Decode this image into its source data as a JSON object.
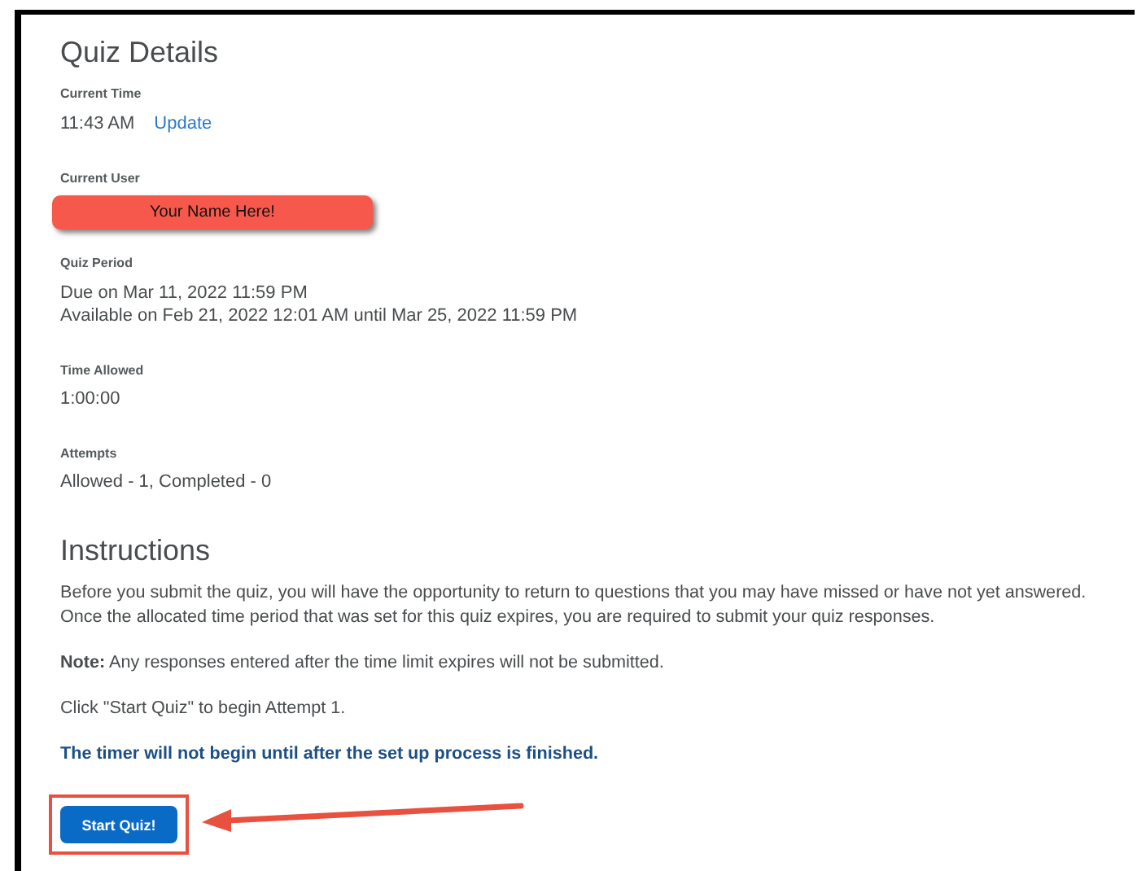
{
  "heading": "Quiz Details",
  "current_time": {
    "label": "Current Time",
    "value": "11:43 AM",
    "link": "Update"
  },
  "current_user": {
    "label": "Current User",
    "name": "Your Name Here!"
  },
  "quiz_period": {
    "label": "Quiz Period",
    "lines": [
      "Due on Mar 11, 2022 11:59 PM",
      "Available on Feb 21, 2022 12:01 AM until Mar 25, 2022 11:59 PM"
    ]
  },
  "time_allowed": {
    "label": "Time Allowed",
    "value": "1:00:00"
  },
  "attempts": {
    "label": "Attempts",
    "value": "Allowed - 1, Completed - 0"
  },
  "instructions": {
    "heading": "Instructions",
    "paragraph": [
      "Before you submit the quiz, you will have the opportunity to return to questions that you may have missed or have not yet answered.",
      "Once the allocated time period that was set for this quiz expires, you are required to submit your quiz responses."
    ],
    "note": "**Note:** Any responses entered after the time limit expires will not be submitted.",
    "click": "Click \"Start Quiz\" to begin Attempt 1.",
    "timer": "The timer will not begin until after the set up process is finished."
  },
  "start_button": "Start Quiz!"
}
